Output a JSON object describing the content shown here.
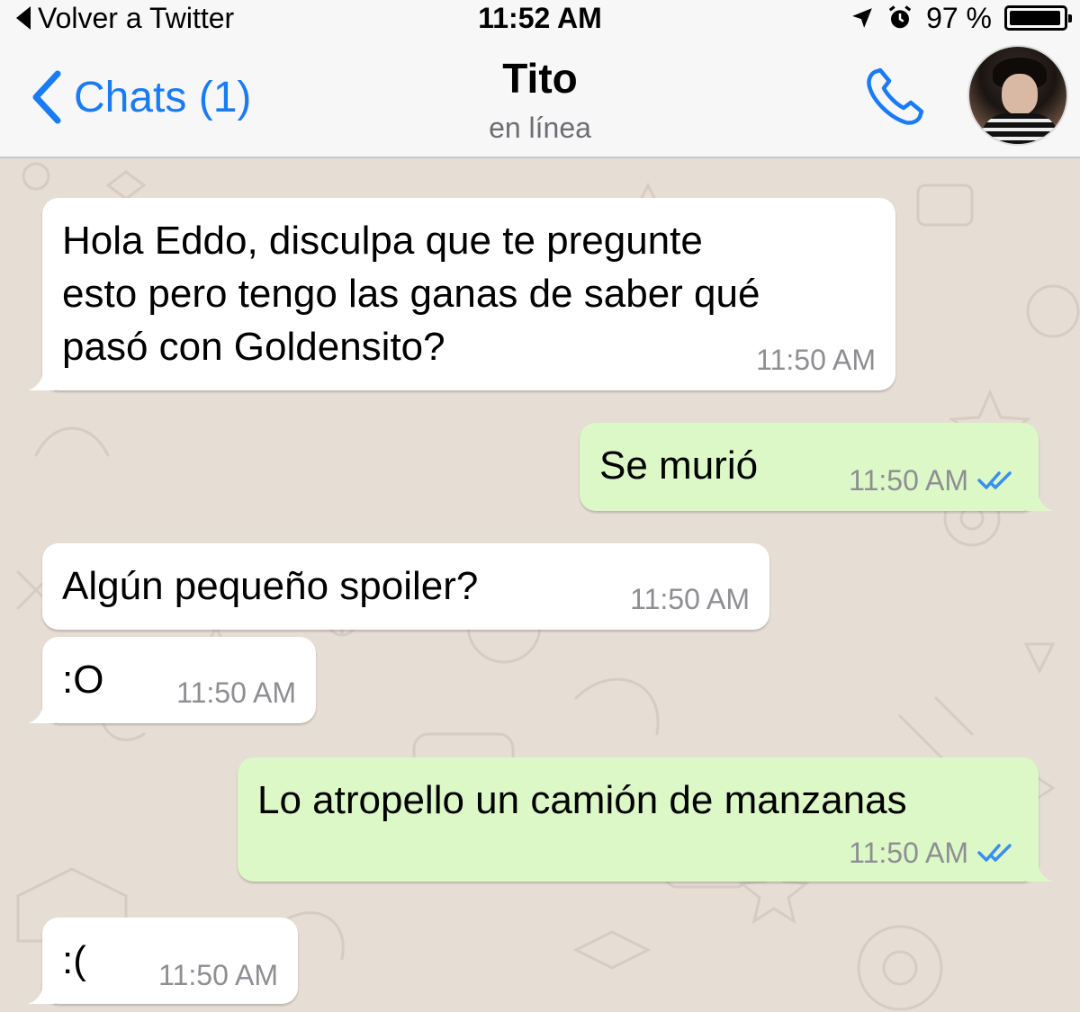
{
  "status_bar": {
    "back_label": "Volver a Twitter",
    "time": "11:52 AM",
    "battery": "97 %",
    "battery_level": 0.97
  },
  "nav": {
    "back_label": "Chats (1)",
    "contact_name": "Tito",
    "contact_status": "en línea"
  },
  "colors": {
    "accent": "#1a7cf5",
    "incoming_bubble": "#ffffff",
    "outgoing_bubble": "#dcf8c6",
    "read_ticks": "#3a8ef0"
  },
  "messages": [
    {
      "direction": "in",
      "lines": [
        "Hola Eddo, disculpa que te pregunte",
        "esto pero tengo las ganas de saber qué",
        "pasó con Goldensito?"
      ],
      "time": "11:50 AM"
    },
    {
      "direction": "out",
      "lines": [
        "Se murió"
      ],
      "time": "11:50 AM",
      "read": true
    },
    {
      "direction": "in",
      "lines": [
        "Algún pequeño spoiler?"
      ],
      "time": "11:50 AM"
    },
    {
      "direction": "in",
      "lines": [
        ":O"
      ],
      "time": "11:50 AM"
    },
    {
      "direction": "out",
      "lines": [
        "Lo atropello un camión de manzanas"
      ],
      "time": "11:50 AM",
      "read": true
    },
    {
      "direction": "in",
      "lines": [
        ":("
      ],
      "time": "11:50 AM"
    }
  ]
}
